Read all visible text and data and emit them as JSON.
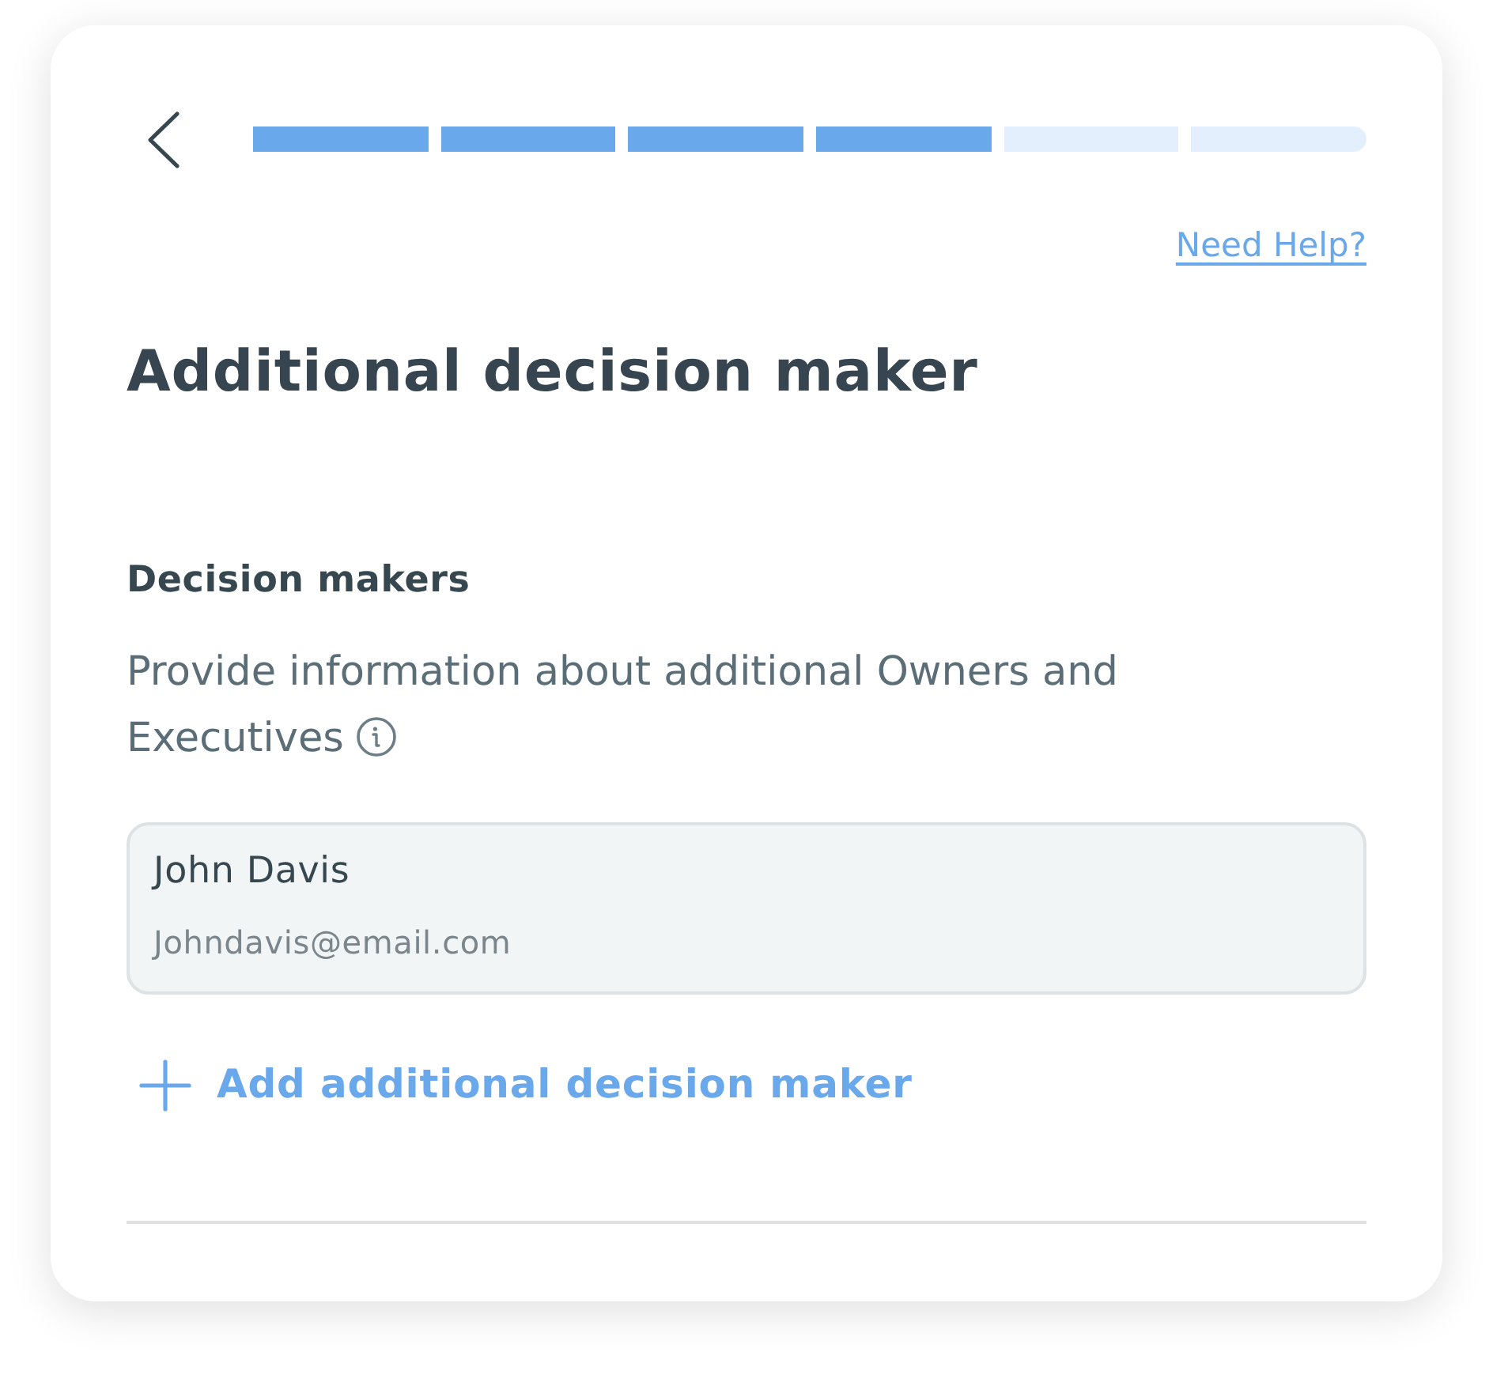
{
  "progress": {
    "steps": [
      {
        "completed": true
      },
      {
        "completed": true
      },
      {
        "completed": true
      },
      {
        "completed": true
      },
      {
        "completed": false
      },
      {
        "completed": false
      }
    ]
  },
  "help_link": "Need Help?",
  "title": "Additional decision maker",
  "section": {
    "heading": "Decision makers",
    "description": "Provide information about additional Owners and Executives"
  },
  "decision_makers": [
    {
      "name": "John Davis",
      "email": "Johndavis@email.com"
    }
  ],
  "add_link": "Add additional decision maker"
}
